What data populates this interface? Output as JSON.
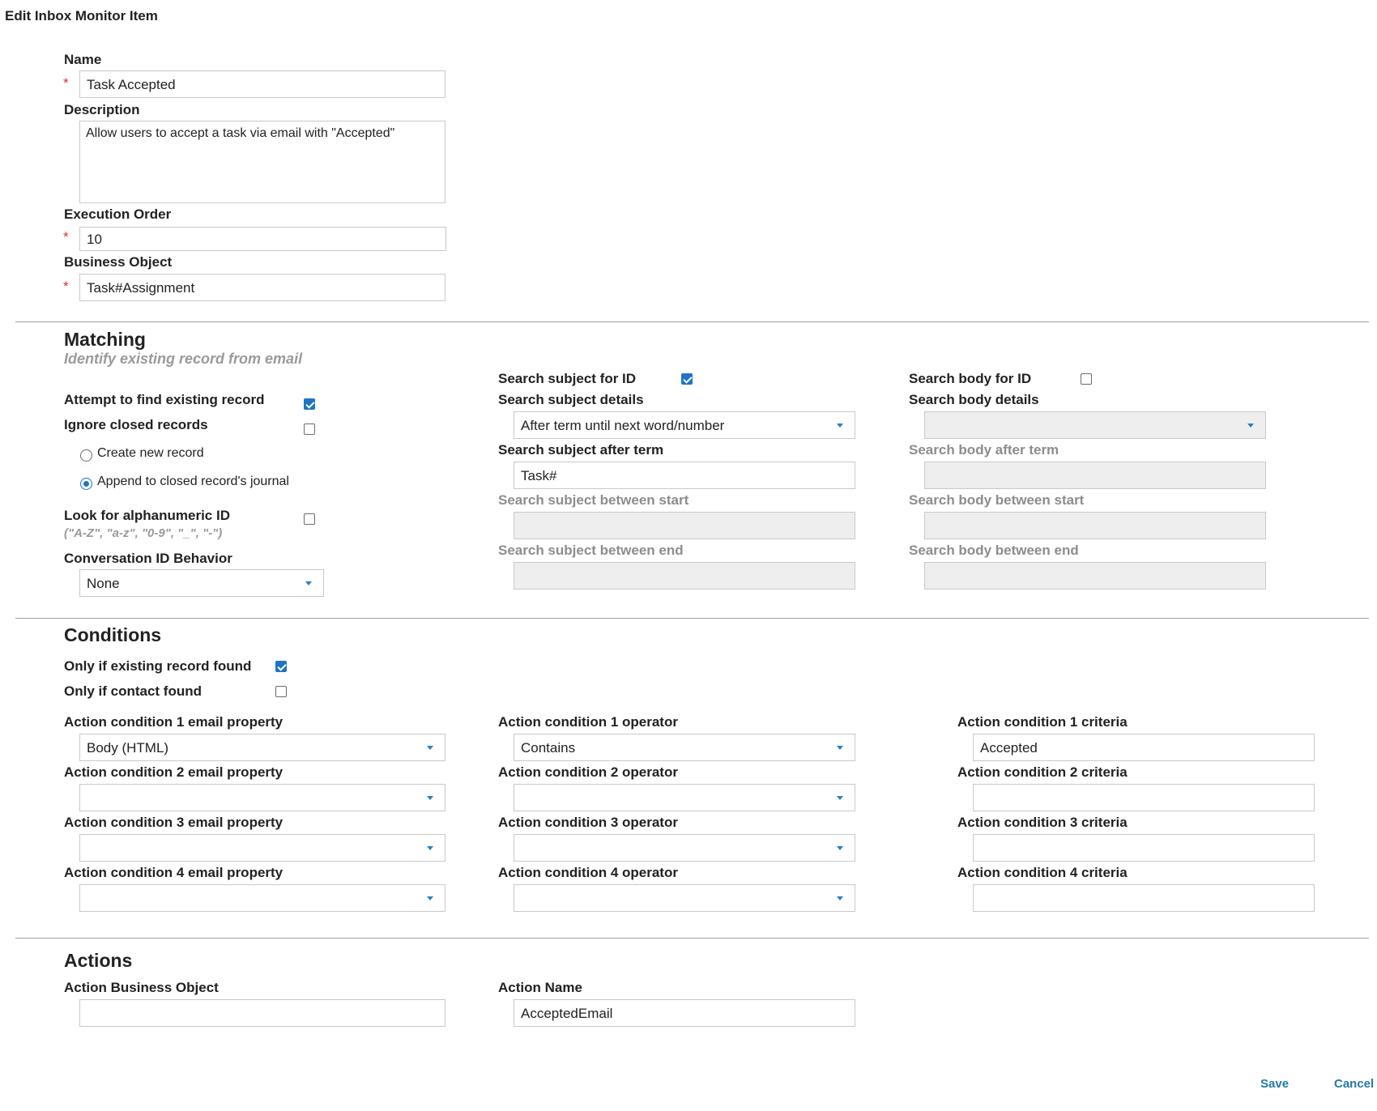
{
  "page": {
    "title": "Edit Inbox Monitor Item"
  },
  "required_marker": "*",
  "general": {
    "name_label": "Name",
    "name_value": "Task Accepted",
    "description_label": "Description",
    "description_value": "Allow users to accept a task via email with \"Accepted\"",
    "execution_order_label": "Execution Order",
    "execution_order_value": "10",
    "business_object_label": "Business Object",
    "business_object_value": "Task#Assignment"
  },
  "matching": {
    "title": "Matching",
    "subtitle": "Identify existing record from email",
    "attempt_find_label": "Attempt to find existing record",
    "attempt_find_checked": true,
    "ignore_closed_label": "Ignore closed records",
    "ignore_closed_checked": false,
    "create_new_label": "Create new record",
    "create_new_selected": false,
    "append_closed_label": "Append to closed record's journal",
    "append_closed_selected": true,
    "alnum_label": "Look for alphanumeric ID",
    "alnum_hint": "(\"A-Z\", \"a-z\", \"0-9\", \"_\", \"-\")",
    "alnum_checked": false,
    "conversation_label": "Conversation ID Behavior",
    "conversation_value": "None",
    "subject_id_label": "Search subject for ID",
    "subject_id_checked": true,
    "subject_details_label": "Search subject details",
    "subject_details_value": "After term until next word/number",
    "subject_after_label": "Search subject after term",
    "subject_after_value": "Task#",
    "subject_between_start_label": "Search subject between start",
    "subject_between_start_value": "",
    "subject_between_end_label": "Search subject between end",
    "subject_between_end_value": "",
    "body_id_label": "Search body for ID",
    "body_id_checked": false,
    "body_details_label": "Search body details",
    "body_details_value": "",
    "body_after_label": "Search body after term",
    "body_after_value": "",
    "body_between_start_label": "Search body between start",
    "body_between_start_value": "",
    "body_between_end_label": "Search body between end",
    "body_between_end_value": ""
  },
  "conditions": {
    "title": "Conditions",
    "only_existing_label": "Only if existing record found",
    "only_existing_checked": true,
    "only_contact_label": "Only if contact found",
    "only_contact_checked": false,
    "rows": [
      {
        "property_label": "Action condition 1 email property",
        "property_value": "Body (HTML)",
        "operator_label": "Action condition 1 operator",
        "operator_value": "Contains",
        "criteria_label": "Action condition 1 criteria",
        "criteria_value": "Accepted"
      },
      {
        "property_label": "Action condition 2 email property",
        "property_value": "",
        "operator_label": "Action condition 2 operator",
        "operator_value": "",
        "criteria_label": "Action condition 2 criteria",
        "criteria_value": ""
      },
      {
        "property_label": "Action condition 3 email property",
        "property_value": "",
        "operator_label": "Action condition 3 operator",
        "operator_value": "",
        "criteria_label": "Action condition 3 criteria",
        "criteria_value": ""
      },
      {
        "property_label": "Action condition 4 email property",
        "property_value": "",
        "operator_label": "Action condition 4 operator",
        "operator_value": "",
        "criteria_label": "Action condition 4 criteria",
        "criteria_value": ""
      }
    ]
  },
  "actions": {
    "title": "Actions",
    "business_object_label": "Action Business Object",
    "business_object_value": "",
    "action_name_label": "Action Name",
    "action_name_value": "AcceptedEmail"
  },
  "footer": {
    "save_label": "Save",
    "cancel_label": "Cancel"
  },
  "colors": {
    "accent": "#1e74c7",
    "link": "#2379a8",
    "required": "#d9302a",
    "disabled_bg": "#eeeeee"
  }
}
